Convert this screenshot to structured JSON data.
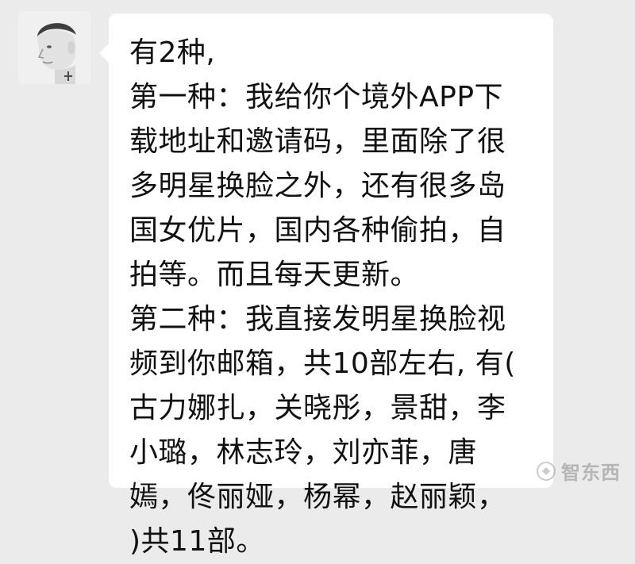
{
  "message": {
    "lines": [
      "有2种,",
      "第一种：我给你个境外APP下",
      "载地址和邀请码，里面除了很",
      "多明星换脸之外，还有很多岛",
      "国女优片，国内各种偷拍，自",
      "拍等。而且每天更新。",
      "第二种：我直接发明星换脸视",
      "频到你邮箱，共10部左右, 有(",
      "古力娜扎，关晓彤，景甜，李",
      "小璐，林志玲，刘亦菲，唐",
      "嫣，佟丽娅，杨幂，赵丽颖，",
      ")共11部。"
    ]
  },
  "watermark": {
    "text": "智东西",
    "icon": "logo-icon"
  },
  "avatar": {
    "icon": "profile-avatar"
  }
}
